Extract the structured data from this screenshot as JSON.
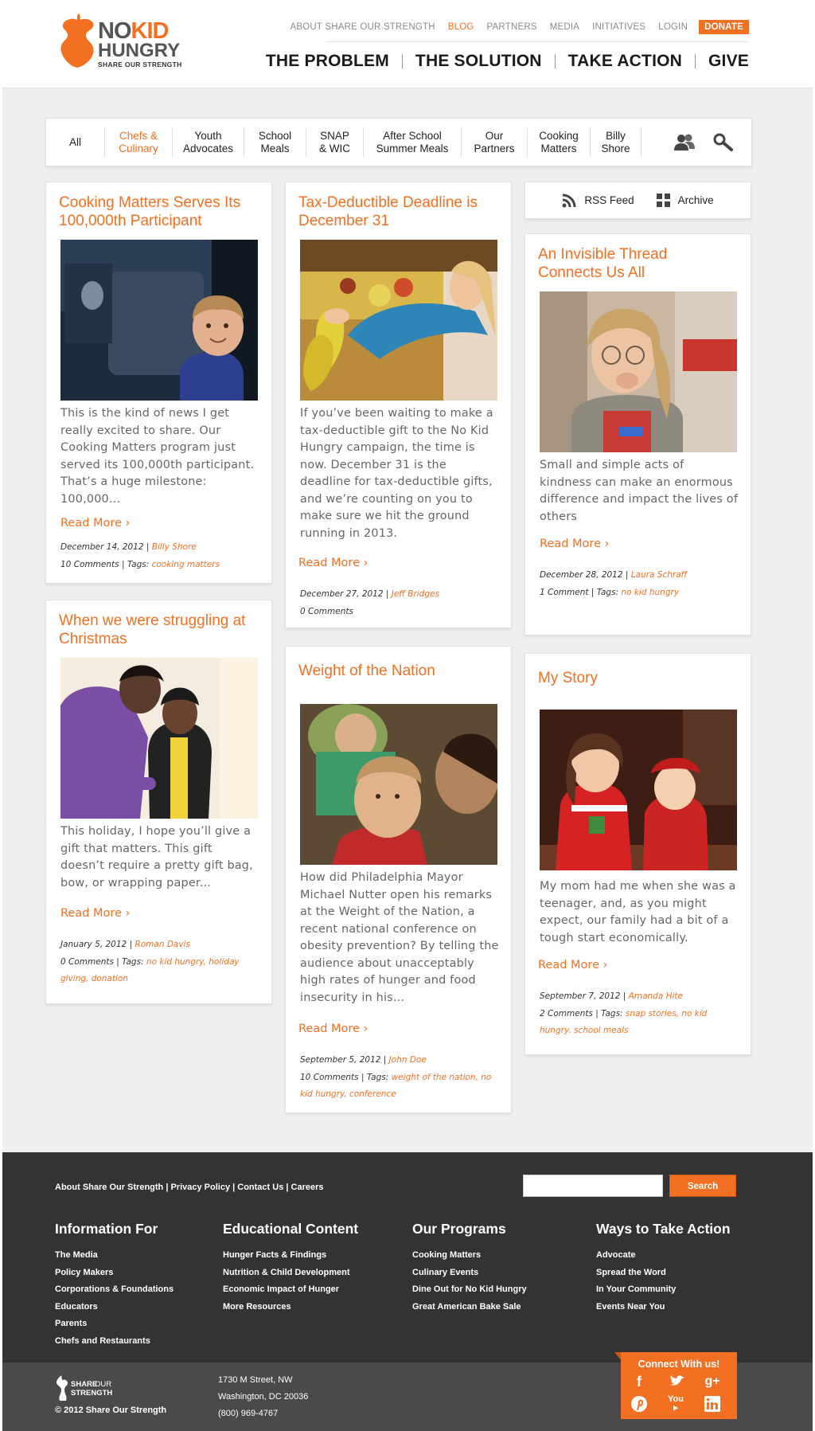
{
  "logo": {
    "no": "NO",
    "kid": "KID",
    "hungry": "HUNGRY",
    "tagline": "SHARE OUR STRENGTH"
  },
  "topnav": [
    {
      "label": "ABOUT SHARE OUR STRENGTH"
    },
    {
      "label": "BLOG"
    },
    {
      "label": "PARTNERS"
    },
    {
      "label": "MEDIA"
    },
    {
      "label": "INITIATIVES"
    },
    {
      "label": "LOGIN"
    },
    {
      "label": "DONATE"
    }
  ],
  "mainnav": [
    {
      "label": "THE PROBLEM"
    },
    {
      "label": "THE SOLUTION"
    },
    {
      "label": "TAKE ACTION"
    },
    {
      "label": "GIVE"
    }
  ],
  "filters": [
    {
      "label": "All"
    },
    {
      "label": "Chefs &\nCulinary"
    },
    {
      "label": "Youth\nAdvocates"
    },
    {
      "label": "School\nMeals"
    },
    {
      "label": "SNAP\n& WIC"
    },
    {
      "label": "After School\nSummer Meals"
    },
    {
      "label": "Our\nPartners"
    },
    {
      "label": "Cooking\nMatters"
    },
    {
      "label": "Billy\nShore"
    }
  ],
  "feed": {
    "rss": "RSS Feed",
    "archive": "Archive"
  },
  "posts": [
    {
      "title": "Cooking Matters Serves Its 100,000th Participant",
      "excerpt": "This is the kind of news I get really excited to share. Our Cooking Matters program just served its 100,000th participant. That’s a huge milestone: 100,000...",
      "read_more": "Read More",
      "date": "December 14, 2012",
      "author": "Billy Shore",
      "comments": "10 Comments",
      "tags_label": "Tags:",
      "tags": "cooking matters"
    },
    {
      "title": "Tax-Deductible Deadline is December 31",
      "excerpt": "If you’ve been waiting to make a tax-deductible gift to the No Kid Hungry campaign, the time is now. December 31 is the deadline for tax-deductible gifts, and we’re counting on you to make sure we hit the ground running in 2013.",
      "read_more": "Read More",
      "date": "December 27, 2012",
      "author": "Jeff Bridges",
      "comments": "0 Comments",
      "tags_label": "",
      "tags": ""
    },
    {
      "title": "An Invisible Thread Connects Us All",
      "excerpt": "Small and simple acts of kindness can make an enormous difference and impact the lives of others",
      "read_more": "Read More",
      "date": "December 28, 2012",
      "author": "Laura Schraff",
      "comments": "1 Comment",
      "tags_label": "Tags:",
      "tags": "no kid hungry"
    },
    {
      "title": "When we were struggling at Christmas",
      "excerpt": "This holiday, I hope you’ll give a gift that matters. This gift doesn’t require a pretty gift bag, bow, or wrapping paper...",
      "read_more": "Read More",
      "date": "January 5, 2012",
      "author": "Roman Davis",
      "comments": "0 Comments",
      "tags_label": "Tags:",
      "tags": "no kid hungry, holiday giving, donation"
    },
    {
      "title": "Weight of the Nation",
      "excerpt": "How did Philadelphia Mayor Michael Nutter open his remarks at the Weight of the Nation, a recent national conference on obesity prevention? By telling the audience about unacceptably high rates of hunger and food insecurity in his...",
      "read_more": "Read More",
      "date": "September 5, 2012",
      "author": "John Doe",
      "comments": "10 Comments",
      "tags_label": "Tags:",
      "tags": "weight of the nation, no kid hungry, conference"
    },
    {
      "title": "My Story",
      "excerpt": "My mom had me when she was a teenager, and, as you might expect, our family had a bit of a tough start economically.",
      "read_more": "Read More",
      "date": "September 7, 2012",
      "author": "Amanda Hite",
      "comments": "2 Comments",
      "tags_label": "Tags:",
      "tags": "snap stories, no kid hungry. school meals"
    }
  ],
  "footer": {
    "links": "About Share Our Strength | Privacy Policy | Contact Us | Careers",
    "search_button": "Search",
    "columns": [
      {
        "heading": "Information For",
        "items": [
          "The Media",
          "Policy Makers",
          "Corporations & Foundations",
          "Educators",
          "Parents",
          "Chefs and Restaurants"
        ]
      },
      {
        "heading": "Educational Content",
        "items": [
          "Hunger Facts & Findings",
          "Nutrition & Child Development",
          "Economic Impact of Hunger",
          "More Resources"
        ]
      },
      {
        "heading": "Our Programs",
        "items": [
          "Cooking Matters",
          "Culinary Events",
          "Dine Out for No Kid Hungry",
          "Great American Bake Sale"
        ]
      },
      {
        "heading": "Ways to Take Action",
        "items": [
          "Advocate",
          "Spread the Word",
          "In Your Community",
          "Events Near You"
        ]
      }
    ],
    "sos_logo": {
      "share": "SHARE",
      "our": "OUR",
      "strength": "STRENGTH"
    },
    "copyright": "© 2012 Share Our Strength",
    "address": [
      "1730 M Street, NW",
      "Washington, DC 20036",
      "(800) 969-4767"
    ],
    "connect": "Connect With us!"
  },
  "colors": {
    "accent": "#f36f21",
    "footer": "#333333",
    "footer_bottom": "#4a4a4a",
    "page_bg": "#efefef"
  }
}
